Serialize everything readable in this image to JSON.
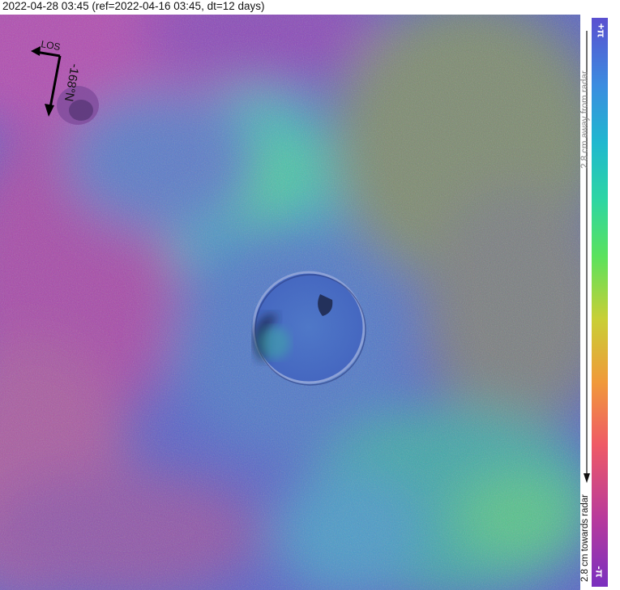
{
  "title": "2022-04-28 03:45 (ref=2022-04-16 03:45, dt=12 days)",
  "overlay": {
    "los_label": "LOS",
    "heading_label": "-168°N"
  },
  "colorbar": {
    "top_symbol": "+π",
    "bottom_symbol": "-π",
    "away_label": "2.8 cm away from radar",
    "toward_label": "2.8 cm towards radar"
  }
}
